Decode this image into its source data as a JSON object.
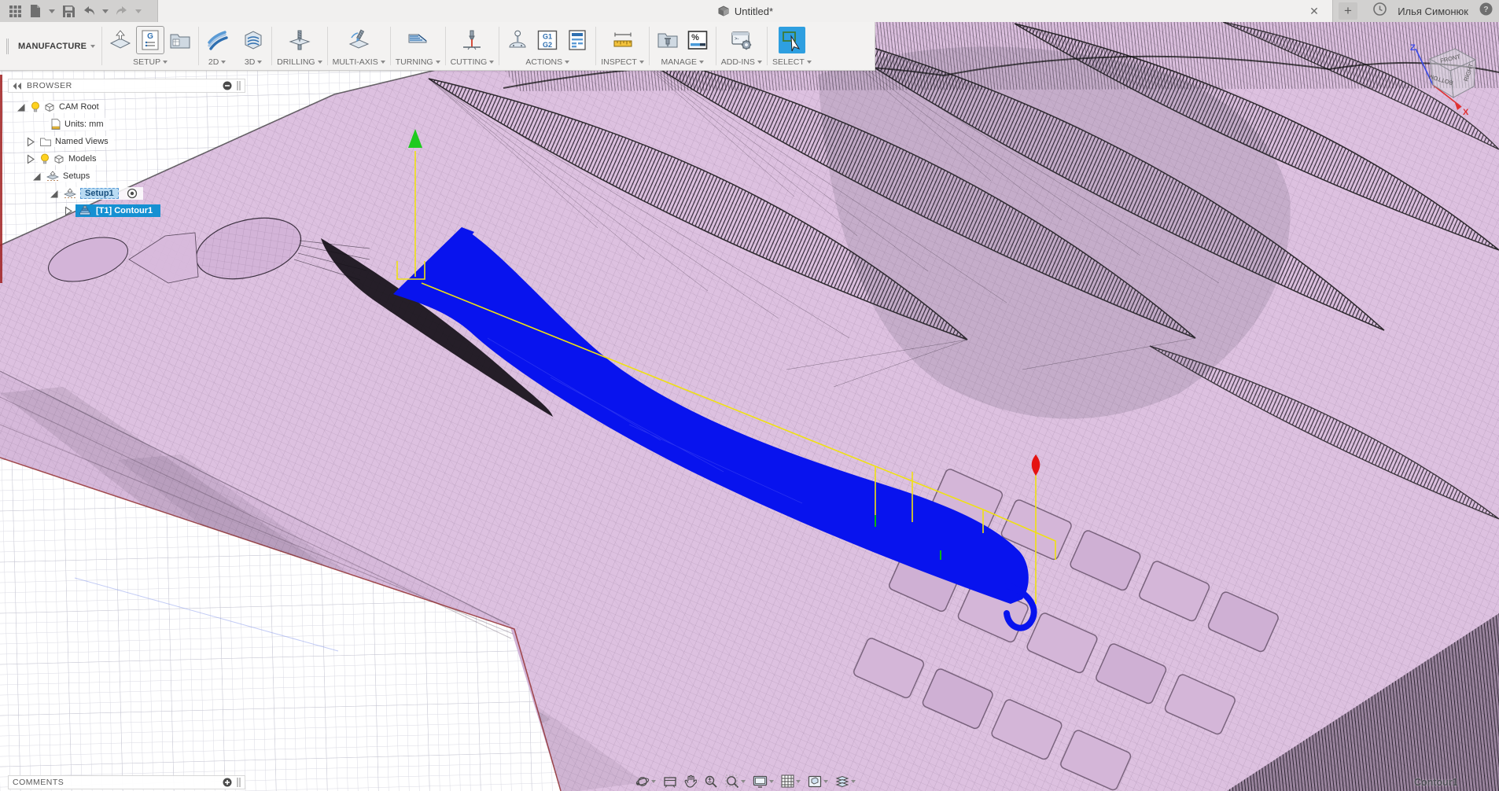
{
  "titlebar": {
    "title": "Untitled*",
    "user": "Илья Симонюк"
  },
  "toolbar": {
    "workspace": "MANUFACTURE",
    "groups": {
      "setup": "SETUP",
      "d2": "2D",
      "d3": "3D",
      "drilling": "DRILLING",
      "multiaxis": "MULTI-AXIS",
      "turning": "TURNING",
      "cutting": "CUTTING",
      "actions": "ACTIONS",
      "inspect": "INSPECT",
      "manage": "MANAGE",
      "addins": "ADD-INS",
      "select": "SELECT"
    },
    "icon_glyphs": {
      "g": "G",
      "g1": "G1",
      "g2": "G2",
      "percent": "%",
      "prompt": ">-"
    }
  },
  "browser": {
    "header": "BROWSER",
    "items": [
      {
        "label": "CAM Root"
      },
      {
        "label": "Units: mm"
      },
      {
        "label": "Named Views"
      },
      {
        "label": "Models"
      },
      {
        "label": "Setups"
      },
      {
        "label": "Setup1"
      },
      {
        "label": "[T1] Contour1"
      }
    ]
  },
  "comments": {
    "header": "COMMENTS"
  },
  "viewport": {
    "status_label": "Contour1",
    "viewcube": {
      "front": "FRONT",
      "right": "RIGHT",
      "bottom": "BOTTOM",
      "axis_x": "X",
      "axis_z": "Z"
    }
  },
  "colors": {
    "model_pink": "#ddc1e0",
    "toolpath_blue": "#0813ee",
    "rapid_yellow": "#efe112",
    "arrow_green": "#1ecb1e",
    "arrow_red": "#e51212",
    "selection_blue": "#1590d2"
  }
}
